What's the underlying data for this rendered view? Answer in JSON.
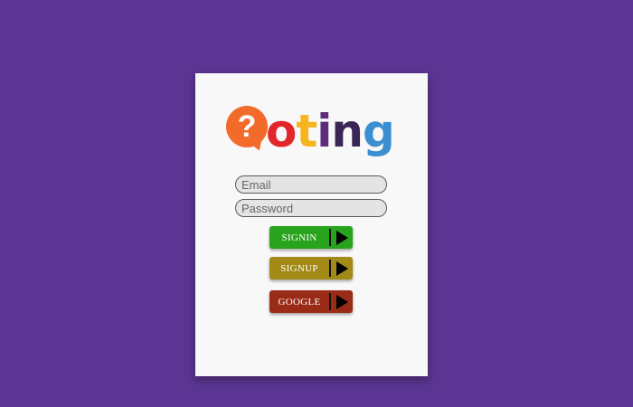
{
  "logo": {
    "symbol": "?",
    "letters": [
      {
        "char": "o",
        "color": "#e3262c"
      },
      {
        "char": "t",
        "color": "#f6b51c"
      },
      {
        "char": "i",
        "color": "#5d2d7a"
      },
      {
        "char": "n",
        "color": "#3a2656"
      },
      {
        "char": "g",
        "color": "#3b8fd1"
      }
    ],
    "bubble_color": "#f26b2a"
  },
  "form": {
    "email_placeholder": "Email",
    "password_placeholder": "Password"
  },
  "buttons": {
    "signin": {
      "label": "SIGNIN",
      "color": "#27a31c"
    },
    "signup": {
      "label": "SIGNUP",
      "color": "#a38a16"
    },
    "google": {
      "label": "GOOGLE",
      "color": "#9a2b17"
    }
  },
  "icons": {
    "arrow": "play-arrow-icon",
    "logo_symbol": "question-bubble-icon"
  },
  "colors": {
    "background": "#5b3593",
    "card": "#f8f8f8"
  }
}
